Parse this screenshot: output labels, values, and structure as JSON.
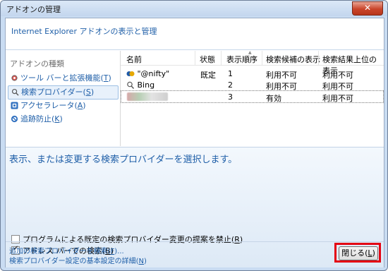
{
  "window": {
    "title": "アドオンの管理",
    "close_glyph": "✕"
  },
  "header": {
    "text": "Internet Explorer アドオンの表示と管理"
  },
  "sidebar": {
    "category_label": "アドオンの種類",
    "items": [
      {
        "label": "ツール バーと拡張機能(",
        "key": "T",
        "suffix": ")",
        "icon": "gear-icon"
      },
      {
        "label": "検索プロバイダー(",
        "key": "S",
        "suffix": ")",
        "icon": "search-icon",
        "selected": true
      },
      {
        "label": "アクセラレータ(",
        "key": "A",
        "suffix": ")",
        "icon": "accelerator-icon"
      },
      {
        "label": "追跡防止(",
        "key": "K",
        "suffix": ")",
        "icon": "block-icon"
      }
    ]
  },
  "table": {
    "columns": [
      "名前",
      "状態",
      "表示順序",
      "検索候補の表示",
      "検索結果上位の表示"
    ],
    "rows": [
      {
        "name": "\"@nifty\"",
        "status": "既定",
        "order": "1",
        "suggest": "利用不可",
        "top": "利用不可",
        "icon": "nifty-icon"
      },
      {
        "name": "Bing",
        "status": "",
        "order": "2",
        "suggest": "利用不可",
        "top": "利用不可",
        "icon": "search-icon"
      },
      {
        "name": "",
        "status": "",
        "order": "3",
        "suggest": "有効",
        "top": "利用不可",
        "icon": "blurred-icon"
      }
    ]
  },
  "details": {
    "description": "表示、または変更する検索プロバイダーを選択します。",
    "checkbox1": {
      "label": "プログラムによる既定の検索プロバイダー変更の提案を禁止(",
      "key": "R",
      "suffix": ")",
      "checked": false
    },
    "checkbox2": {
      "label": "アドレス バーでの検索(",
      "key": "B",
      "suffix": ")",
      "checked": true
    }
  },
  "footer": {
    "link1": {
      "label": "追加の検索プロバイダーを検索(",
      "key": "F",
      "suffix": ")..."
    },
    "link2": {
      "label": "検索プロバイダー設定の基本設定の詳細(",
      "key": "N",
      "suffix": ")"
    },
    "close_button": {
      "label": "閉じる(",
      "key": "L",
      "suffix": ")"
    }
  },
  "colors": {
    "accent": "#1f5fa8",
    "highlight": "#e40012"
  }
}
